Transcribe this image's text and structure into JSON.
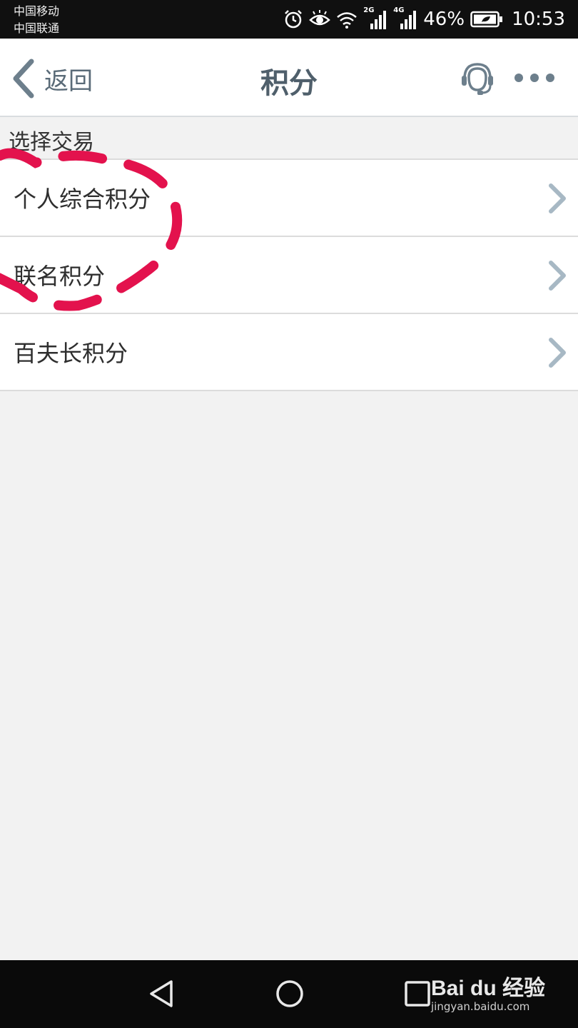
{
  "status_bar": {
    "carrier_1": "中国移动",
    "carrier_2": "中国联通",
    "network_1": "2G",
    "network_2": "4G",
    "battery": "46%",
    "time": "10:53"
  },
  "nav": {
    "back_label": "返回",
    "title": "积分"
  },
  "section": {
    "header": "选择交易"
  },
  "list": {
    "items": [
      {
        "label": "个人综合积分"
      },
      {
        "label": "联名积分"
      },
      {
        "label": "百夫长积分"
      }
    ]
  },
  "watermark": {
    "logo": "Bai du 经验",
    "url": "jingyan.baidu.com"
  },
  "colors": {
    "nav_text": "#5a6b78",
    "title_text": "#4f5f6b",
    "annotation": "#e3124d",
    "chevron": "#a7b8c4",
    "background": "#f2f2f2"
  }
}
